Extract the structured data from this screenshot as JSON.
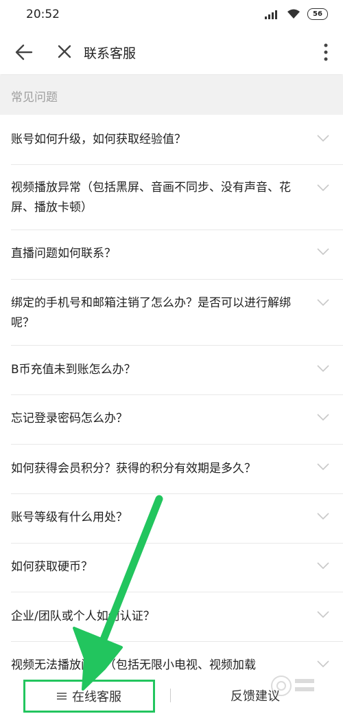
{
  "status_bar": {
    "time": "20:52",
    "battery": "56"
  },
  "app_bar": {
    "title": "联系客服"
  },
  "section": {
    "title": "常见问题"
  },
  "faq_items": [
    {
      "question": "账号如何升级，如何获取经验值？"
    },
    {
      "question": "视频播放异常（包括黑屏、音画不同步、没有声音、花屏、播放卡顿）"
    },
    {
      "question": "直播问题如何联系？"
    },
    {
      "question": "绑定的手机号和邮箱注销了怎么办？是否可以进行解绑呢？"
    },
    {
      "question": "B币充值未到账怎么办？"
    },
    {
      "question": "忘记登录密码怎么办？"
    },
    {
      "question": "如何获得会员积分？获得的积分有效期是多久？"
    },
    {
      "question": "账号等级有什么用处？"
    },
    {
      "question": "如何获取硬币？"
    },
    {
      "question": "企业/团队或个人如何认证？"
    },
    {
      "question": "视频无法播放问题（包括无限小电视、视频加载"
    }
  ],
  "bottom_bar": {
    "online_service": "在线客服",
    "feedback": "反馈建议"
  },
  "colors": {
    "annotation_green": "#22c55e",
    "section_bg": "#f1f1f1",
    "muted_text": "#9e9e9e"
  }
}
